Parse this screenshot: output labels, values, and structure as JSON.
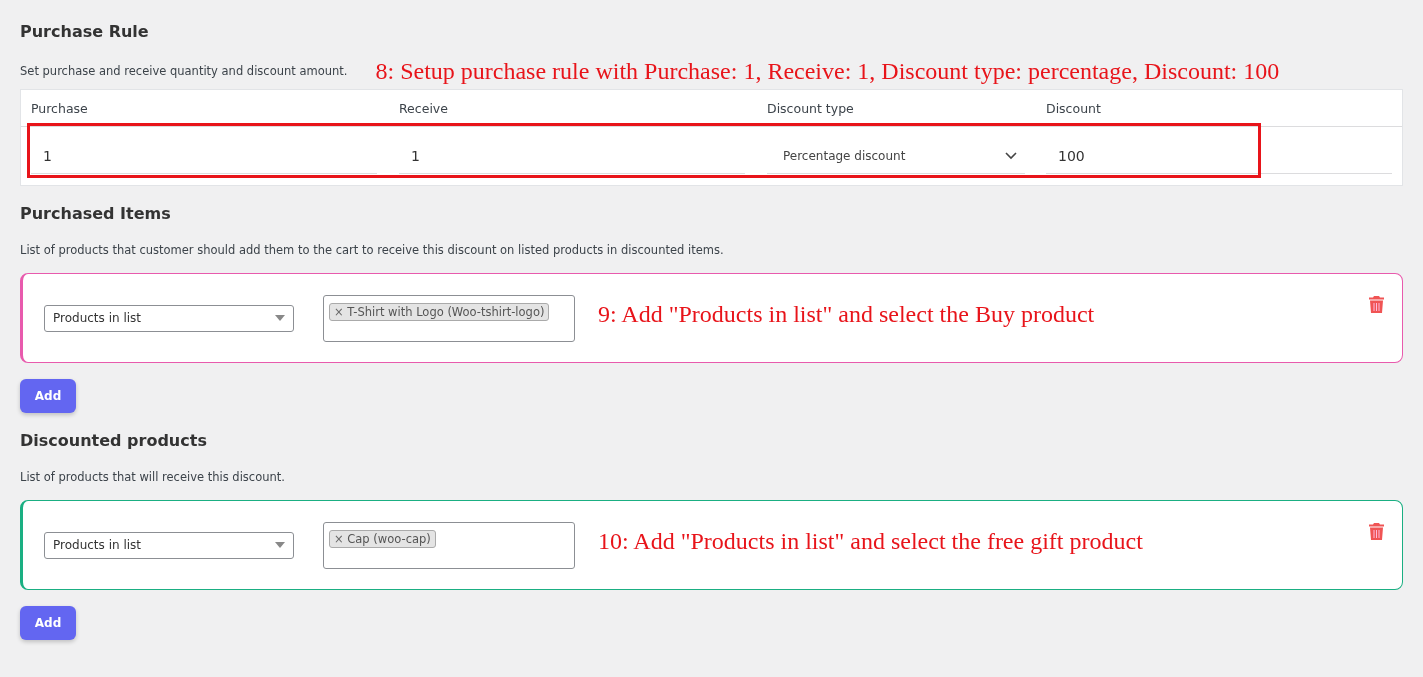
{
  "purchase_rule": {
    "title": "Purchase Rule",
    "description": "Set purchase and receive quantity and discount amount.",
    "annotation": "8: Setup purchase rule with Purchase: 1, Receive: 1, Discount type: percentage, Discount: 100",
    "columns": [
      {
        "label": "Purchase",
        "kind": "input",
        "value": "1"
      },
      {
        "label": "Receive",
        "kind": "input",
        "value": "1"
      },
      {
        "label": "Discount type",
        "kind": "select",
        "value": "Percentage discount"
      },
      {
        "label": "Discount",
        "kind": "input",
        "value": "100"
      }
    ]
  },
  "sections": [
    {
      "title": "Purchased Items",
      "description": "List of products that customer should add them to the cart to receive this discount on listed products in discounted items.",
      "color": "#e85aad",
      "condition": "Products in list",
      "tags": [
        {
          "remove": "×",
          "label": "T-Shirt with Logo (Woo-tshirt-logo)"
        }
      ],
      "annotation": "9: Add \"Products in list\" and select the Buy product",
      "button": "Add"
    },
    {
      "title": "Discounted products",
      "description": "List of products that will receive this discount.",
      "color": "#1aaf82",
      "condition": "Products in list",
      "tags": [
        {
          "remove": "×",
          "label": "Cap (woo-cap)"
        }
      ],
      "annotation": "10: Add \"Products in list\" and select the free gift product",
      "button": "Add"
    }
  ]
}
